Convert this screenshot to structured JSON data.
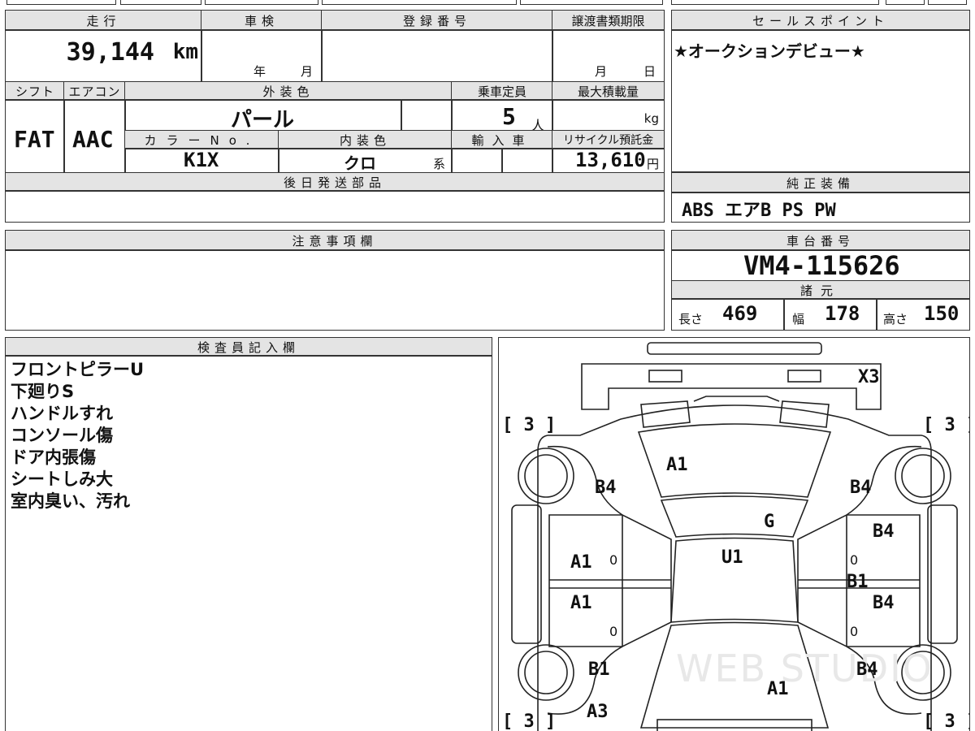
{
  "header": {
    "mileage_label": "走行",
    "mileage": "39,144",
    "mileage_unit": "km",
    "shaken_label": "車検",
    "shaken_year": "年",
    "shaken_month": "月",
    "reg_label": "登録番号",
    "transfer_label": "譲渡書類期限",
    "transfer_month": "月",
    "transfer_day": "日"
  },
  "specs": {
    "shift_label": "シフト",
    "shift": "FAT",
    "ac_label": "エアコン",
    "ac": "AAC",
    "ext_color_label": "外装色",
    "ext_color": "パール",
    "capacity_label": "乗車定員",
    "capacity": "5",
    "capacity_unit": "人",
    "maxload_label": "最大積載量",
    "maxload_unit": "kg",
    "color_no_label": "カラーNo.",
    "color_no": "K1X",
    "int_color_label": "内装色",
    "int_color": "クロ",
    "int_color_suffix": "系",
    "import_label": "輸入車",
    "recycle_label": "リサイクル預託金",
    "recycle": "13,610",
    "recycle_unit": "円",
    "later_parts_label": "後日発送部品"
  },
  "sales": {
    "label": "セールスポイント",
    "text": "★オークションデビュー★"
  },
  "equipment": {
    "label": "純正装備",
    "items": "ABS エアB PS PW"
  },
  "notes": {
    "label": "注意事項欄"
  },
  "chassis": {
    "label": "車台番号",
    "number": "VM4-115626",
    "dims_label": "諸元",
    "length_label": "長さ",
    "length": "469",
    "width_label": "幅",
    "width": "178",
    "height_label": "高さ",
    "height": "150"
  },
  "inspector": {
    "label": "検査員記入欄",
    "lines": [
      "フロントピラーU",
      "下廻りS",
      "ハンドルすれ",
      "コンソール傷",
      "ドア内張傷",
      "シートしみ大",
      "室内臭い、汚れ"
    ]
  },
  "diagram": {
    "tire_marks": [
      "[ 3 ]",
      "[ 3 ]",
      "[ 3 ]",
      "[ 3 ]"
    ],
    "codes": {
      "x3": "X3",
      "hood": "A1",
      "fender_l": "B4",
      "fender_r": "B4",
      "glass": "G",
      "roof": "U1",
      "door_fl": "A1",
      "door_rl": "A1",
      "door_fr": "B4",
      "door_rr": "B4",
      "sill_r": "B1",
      "quarter_l": "B1",
      "quarter_r": "B4",
      "trunk": "A1",
      "rear_l": "A3",
      "zero": "0"
    },
    "watermark": "WEB STUDIO"
  }
}
